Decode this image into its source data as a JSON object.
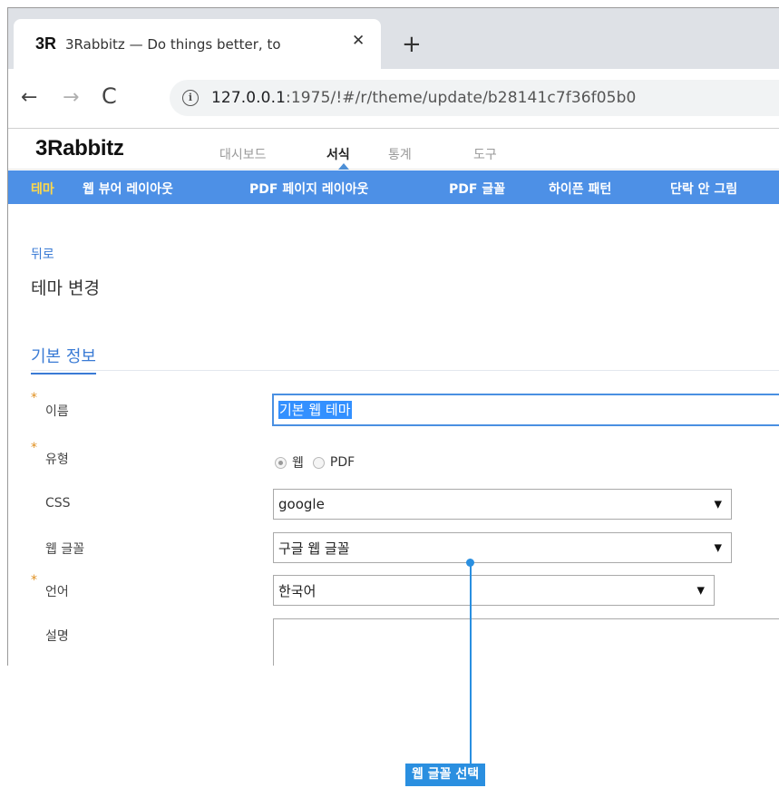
{
  "browser": {
    "tab": {
      "logo": "3R",
      "title": "3Rabbitz — Do things better, to",
      "close_icon": "close-icon"
    },
    "new_tab_icon": "plus-icon",
    "nav": {
      "back_icon": "arrow-left-icon",
      "forward_icon": "arrow-right-icon",
      "reload_icon": "reload-icon"
    },
    "address": {
      "info_icon": "info-icon",
      "host": "127.0.0.1",
      "rest": ":1975/!#/r/theme/update/b28141c7f36f05b0"
    }
  },
  "app": {
    "logo": {
      "prefix": "3",
      "rest": "Rabbitz"
    },
    "main_nav": [
      {
        "label": "대시보드",
        "active": false
      },
      {
        "label": "서식",
        "active": true
      },
      {
        "label": "통계",
        "active": false
      },
      {
        "label": "도구",
        "active": false
      }
    ],
    "sub_nav": [
      {
        "label": "테마",
        "active": true
      },
      {
        "label": "웹 뷰어 레이아웃",
        "active": false
      },
      {
        "label": "PDF 페이지 레이아웃",
        "active": false
      },
      {
        "label": "PDF 글꼴",
        "active": false
      },
      {
        "label": "하이픈 패턴",
        "active": false
      },
      {
        "label": "단락 안 그림",
        "active": false
      }
    ]
  },
  "page": {
    "back_link": "뒤로",
    "title": "테마 변경",
    "section": "기본 정보",
    "form": {
      "required_mark": "*",
      "name": {
        "label": "이름",
        "value": "기본 웹 테마"
      },
      "type": {
        "label": "유형",
        "options": [
          "웹",
          "PDF"
        ],
        "selected": "웹"
      },
      "css": {
        "label": "CSS",
        "value": "google"
      },
      "web_font": {
        "label": "웹 글꼴",
        "value": "구글 웹 글꼴"
      },
      "language": {
        "label": "언어",
        "value": "한국어"
      },
      "description": {
        "label": "설명",
        "value": ""
      },
      "dropdown_icon": "▼"
    }
  },
  "callout": {
    "text": "웹 글꼴 선택",
    "color": "#2a8fe0"
  },
  "colors": {
    "subnav_bg": "#4d90e6",
    "active_subnav": "#ffd84a",
    "link": "#3a7bd5",
    "required": "#e09020"
  }
}
